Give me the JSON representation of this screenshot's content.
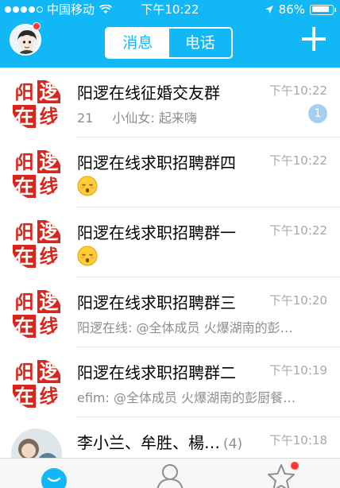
{
  "status_bar": {
    "carrier": "中国移动",
    "time": "下午10:22",
    "battery": "86%",
    "battery_level": 0.86
  },
  "header": {
    "tabs": [
      {
        "label": "消息",
        "active": true
      },
      {
        "label": "电话",
        "active": false
      }
    ]
  },
  "colors": {
    "brand": "#12b7f5",
    "group_red": "#d9261c",
    "badge_red": "#ff3b30",
    "unread_badge": "#a5cff0"
  },
  "conversations": [
    {
      "title": "阳逻在线征婚交友群",
      "time": "下午10:22",
      "preview_count": "21",
      "preview": "小仙女: 起来嗨",
      "unread": "1",
      "emoji": false
    },
    {
      "title": "阳逻在线求职招聘群四",
      "time": "下午10:22",
      "preview": "",
      "emoji": true
    },
    {
      "title": "阳逻在线求职招聘群一",
      "time": "下午10:22",
      "preview": "",
      "emoji": true
    },
    {
      "title": "阳逻在线求职招聘群三",
      "time": "下午10:20",
      "preview": "阳逻在线: @全体成员 火爆湖南的彭…",
      "emoji": false
    },
    {
      "title": "阳逻在线求职招聘群二",
      "time": "下午10:19",
      "preview": "efim: @全体成员 火爆湖南的彭厨餐…",
      "emoji": false
    },
    {
      "title": "李小兰、牟胜、楊…",
      "count": "(4)",
      "time": "下午10:18",
      "preview": "",
      "emoji": false
    }
  ],
  "group_logo_text": [
    "阳",
    "逻",
    "在",
    "线"
  ]
}
